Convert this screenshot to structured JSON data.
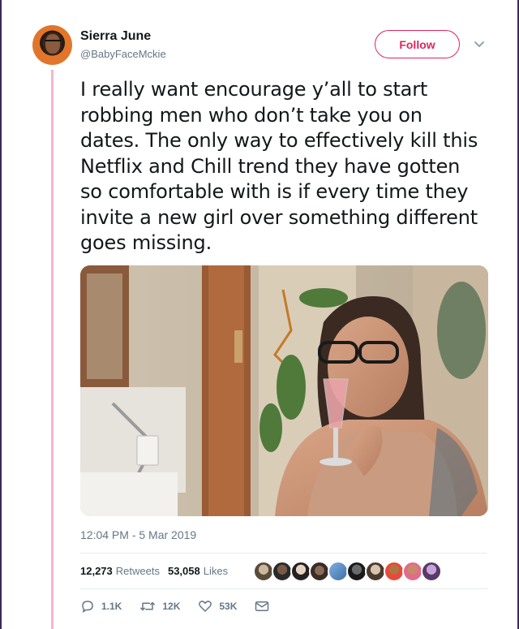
{
  "user": {
    "name": "Sierra June",
    "handle": "@BabyFaceMckie"
  },
  "follow_label": "Follow",
  "tweet": {
    "text_lines": [
      "I really want encourage y’all to start",
      "robbing men who don’t take you on",
      "dates. The only way to effectively kill this",
      "Netflix and Chill trend they have gotten",
      "so comfortable with is if every time they",
      "invite a new girl over something different",
      "goes missing."
    ],
    "timestamp": "12:04 PM - 5 Mar 2019"
  },
  "stats": {
    "retweets_count": "12,273",
    "retweets_label": "Retweets",
    "likes_count": "53,058",
    "likes_label": "Likes"
  },
  "actions": {
    "reply_count": "1.1K",
    "retweet_count": "12K",
    "like_count": "53K"
  },
  "colors": {
    "accent": "#e0245e",
    "thread_line": "#f0b6d0",
    "muted": "#657786"
  }
}
